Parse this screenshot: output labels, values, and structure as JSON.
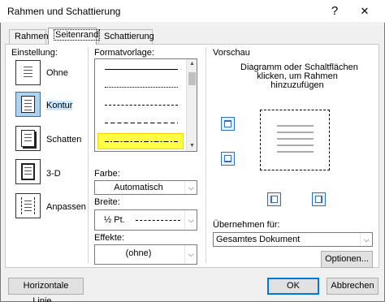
{
  "window": {
    "title": "Rahmen und Schattierung",
    "help_glyph": "?",
    "close_glyph": "✕"
  },
  "tabs": [
    {
      "label": "Rahmen",
      "active": false
    },
    {
      "label": "Seitenrand",
      "active": true
    },
    {
      "label": "Schattierung",
      "active": false
    }
  ],
  "settings": {
    "heading": "Einstellung:",
    "items": [
      {
        "label": "Ohne",
        "icon": "settings-none-icon"
      },
      {
        "label": "Kontur",
        "icon": "settings-box-icon",
        "selected": true
      },
      {
        "label": "Schatten",
        "icon": "settings-shadow-icon"
      },
      {
        "label": "3-D",
        "icon": "settings-3d-icon"
      },
      {
        "label": "Anpassen",
        "icon": "settings-custom-icon"
      }
    ]
  },
  "style_list": {
    "heading": "Formatvorlage:",
    "styles": [
      "solid",
      "dotted",
      "dashed-small",
      "dashed",
      "dash-dot"
    ],
    "selected_index": 4,
    "scroll_up": "▲",
    "scroll_down": "▼"
  },
  "color": {
    "label": "Farbe:",
    "value": "Automatisch"
  },
  "width": {
    "label": "Breite:",
    "value": "½ Pt."
  },
  "effects": {
    "label": "Effekte:",
    "value": "(ohne)"
  },
  "preview": {
    "heading": "Vorschau",
    "hint": [
      "Diagramm oder Schaltflächen",
      "klicken, um Rahmen",
      "hinzuzufügen"
    ]
  },
  "apply_to": {
    "label": "Übernehmen für:",
    "value": "Gesamtes Dokument"
  },
  "buttons": {
    "options": "Optionen...",
    "horizontal_line": "Horizontale Linie...",
    "ok": "OK",
    "cancel": "Abbrechen"
  },
  "colors": {
    "selection": "#a9d4f5",
    "highlight": "#ffff44",
    "accent": "#0078d7"
  }
}
